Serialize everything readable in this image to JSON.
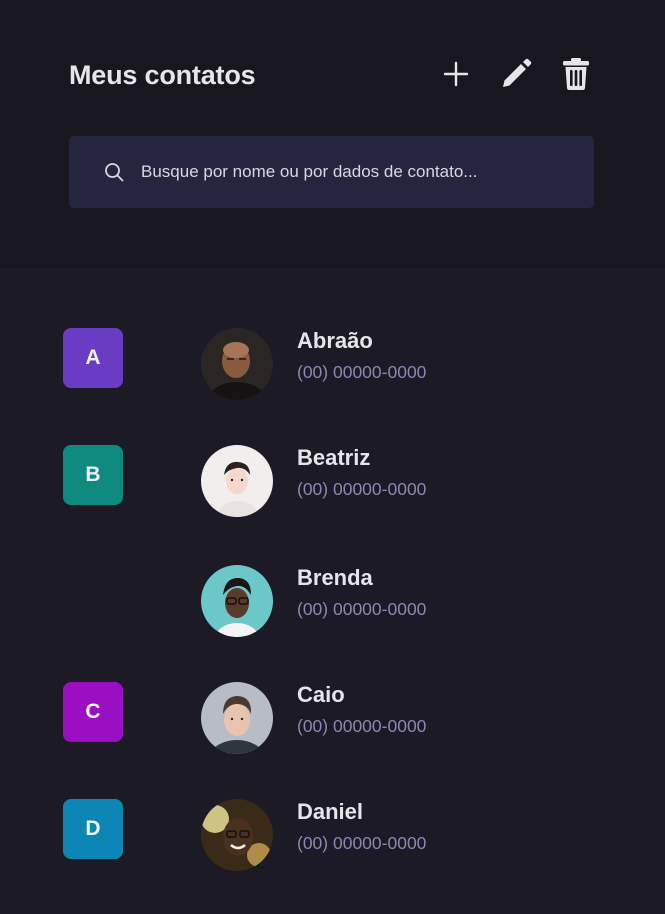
{
  "header": {
    "title": "Meus contatos",
    "actions": [
      {
        "name": "add-contact-button",
        "icon": "plus-icon"
      },
      {
        "name": "edit-contact-button",
        "icon": "pencil-icon"
      },
      {
        "name": "delete-contact-button",
        "icon": "trash-icon"
      }
    ]
  },
  "search": {
    "icon": "search-icon",
    "placeholder": "Busque por nome ou por dados de contato...",
    "value": ""
  },
  "groups": [
    {
      "letter": "A",
      "color": "#6a3cc4"
    },
    {
      "letter": "B",
      "color": "#0e8a7e"
    },
    {
      "letter": "C",
      "color": "#9a0fc2"
    },
    {
      "letter": "D",
      "color": "#0c86b4"
    }
  ],
  "contacts": [
    {
      "name": "Abraão",
      "phone": "(00) 00000-0000"
    },
    {
      "name": "Beatriz",
      "phone": "(00) 00000-0000"
    },
    {
      "name": "Brenda",
      "phone": "(00) 00000-0000"
    },
    {
      "name": "Caio",
      "phone": "(00) 00000-0000"
    },
    {
      "name": "Daniel",
      "phone": "(00) 00000-0000"
    }
  ],
  "colors": {
    "background": "#1c1a24",
    "header_background": "#18171f",
    "search_background": "#262540",
    "text": "#e6e6ea",
    "phone_text": "#8a88b3"
  }
}
